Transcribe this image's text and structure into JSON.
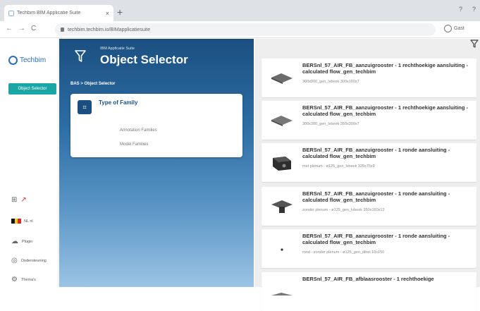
{
  "browser": {
    "tab_title": "Techbim BIM Applicatie Suite",
    "tab_close": "×",
    "new_tab": "+",
    "minimize": "?",
    "more": "?",
    "back": "←",
    "forward": "→",
    "reload": "C",
    "url": "techbim.techbim.io/BIMapplicatiesuite",
    "profile_label": "Gast"
  },
  "sidebar": {
    "logo_text": "Techbim",
    "selected_item": "Object Selector",
    "language_label": "NL nl",
    "items": [
      {
        "icon": "grid-icon",
        "label": ""
      },
      {
        "icon": "plugin-icon",
        "label": "Plugin"
      },
      {
        "icon": "support-icon",
        "label": "Ondersteuning"
      },
      {
        "icon": "theme-icon",
        "label": "Thema's"
      }
    ]
  },
  "header": {
    "suite_label": "IBM Applicatie Suite",
    "title": "Object Selector",
    "breadcrumb": "BAS > Object Selector"
  },
  "family_card": {
    "title": "Type of Family",
    "options": [
      "Annotation Families",
      "Model Families"
    ]
  },
  "results": [
    {
      "title": "BERSnl_57_AIR_FB_aanzuigrooster - 1 rechthoekige aansluiting - calculated flow_gen_techbim",
      "subtitle": "300x900_gen_lvbeek 300x160x7",
      "thumb": "rect-grille"
    },
    {
      "title": "BERSnl_57_AIR_FB_aanzuigrooster - 1 rechthoekige aansluiting - calculated flow_gen_techbim",
      "subtitle": "300x300_gen_lvbeek 350x300x7",
      "thumb": "rect-grille"
    },
    {
      "title": "BERSnl_57_AIR_FB_aanzuigrooster - 1 ronde aansluiting - calculated flow_gen_techbim",
      "subtitle": "met plenum - ø125_gen_lvbeek 325x75x9",
      "thumb": "plenum-box"
    },
    {
      "title": "BERSnl_57_AIR_FB_aanzuigrooster - 1 ronde aansluiting - calculated flow_gen_techbim",
      "subtitle": "zonder plenum - ø125_gen_lvbeek 350x160x12",
      "thumb": "round-grille"
    },
    {
      "title": "BERSnl_57_AIR_FB_aanzuigrooster - 1 ronde aansluiting - calculated flow_gen_techbim",
      "subtitle": "rond - zonder plenum - ø125_gen_dibel 10x150",
      "thumb": "small-dot"
    },
    {
      "title": "BERSnl_57_AIR_FB_afblaasrooster - 1 rechthoekige",
      "subtitle": "",
      "thumb": "rect-grille"
    }
  ]
}
